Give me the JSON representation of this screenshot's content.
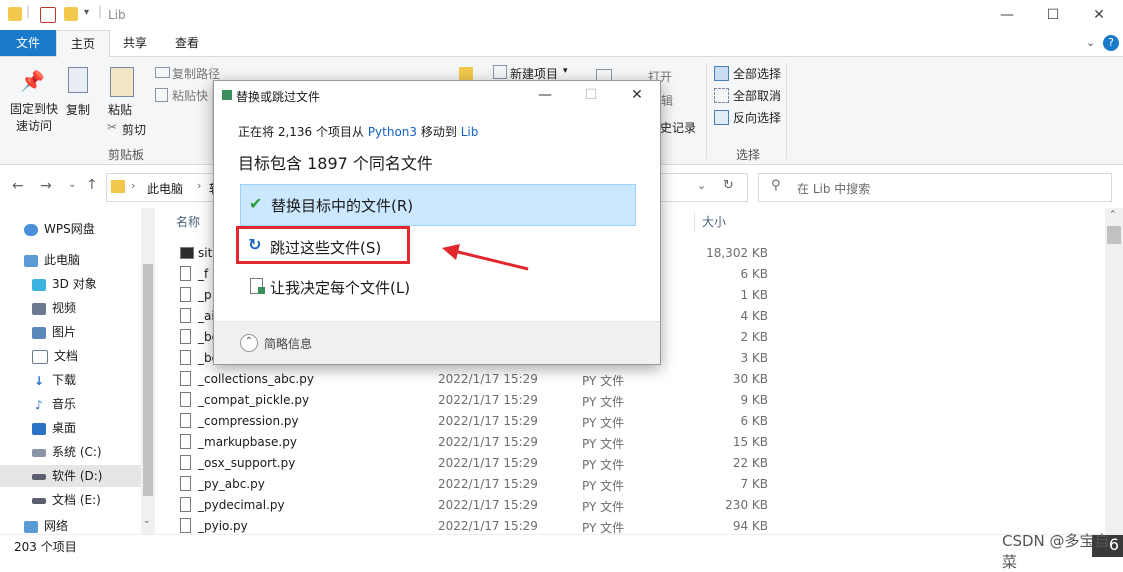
{
  "window": {
    "title": "Lib"
  },
  "tabs": {
    "file": "文件",
    "home": "主页",
    "share": "共享",
    "view": "查看"
  },
  "ribbon": {
    "pin": "固定到快\n速访问",
    "copy": "复制",
    "paste": "粘贴",
    "copy_path": "复制路径",
    "paste_shortcut": "粘贴快",
    "cut": "剪切",
    "clipboard_group": "剪贴板",
    "new_item": "新建项目",
    "open": "打开",
    "history_frag": "史记录",
    "edit_frag": "辑",
    "select_all": "全部选择",
    "select_none": "全部取消",
    "invert_select": "反向选择",
    "select_group": "选择"
  },
  "address": {
    "this_pc": "此电脑",
    "frag": "软"
  },
  "search": {
    "placeholder": "在 Lib 中搜索"
  },
  "sidebar": {
    "items": [
      {
        "label": "WPS网盘"
      },
      {
        "label": "此电脑"
      },
      {
        "label": "3D 对象"
      },
      {
        "label": "视频"
      },
      {
        "label": "图片"
      },
      {
        "label": "文档"
      },
      {
        "label": "下载"
      },
      {
        "label": "音乐"
      },
      {
        "label": "桌面"
      },
      {
        "label": "系统 (C:)"
      },
      {
        "label": "软件 (D:)"
      },
      {
        "label": "文档 (E:)"
      },
      {
        "label": "网络"
      }
    ]
  },
  "columns": {
    "name": "名称",
    "size": "大小"
  },
  "files": [
    {
      "name": "site",
      "date": "",
      "type": "",
      "size": "18,302 KB"
    },
    {
      "name": "_f",
      "date": "",
      "type": "",
      "size": "6 KB"
    },
    {
      "name": "_p",
      "date": "",
      "type": "",
      "size": "1 KB"
    },
    {
      "name": "_ai",
      "date": "",
      "type": "",
      "size": "4 KB"
    },
    {
      "name": "_bo",
      "date": "",
      "type": "",
      "size": "2 KB"
    },
    {
      "name": "_bo",
      "date": "",
      "type": "",
      "size": "3 KB"
    },
    {
      "name": "_collections_abc.py",
      "date": "2022/1/17 15:29",
      "type": "PY 文件",
      "size": "30 KB"
    },
    {
      "name": "_compat_pickle.py",
      "date": "2022/1/17 15:29",
      "type": "PY 文件",
      "size": "9 KB"
    },
    {
      "name": "_compression.py",
      "date": "2022/1/17 15:29",
      "type": "PY 文件",
      "size": "6 KB"
    },
    {
      "name": "_markupbase.py",
      "date": "2022/1/17 15:29",
      "type": "PY 文件",
      "size": "15 KB"
    },
    {
      "name": "_osx_support.py",
      "date": "2022/1/17 15:29",
      "type": "PY 文件",
      "size": "22 KB"
    },
    {
      "name": "_py_abc.py",
      "date": "2022/1/17 15:29",
      "type": "PY 文件",
      "size": "7 KB"
    },
    {
      "name": "_pydecimal.py",
      "date": "2022/1/17 15:29",
      "type": "PY 文件",
      "size": "230 KB"
    },
    {
      "name": "_pyio.py",
      "date": "2022/1/17 15:29",
      "type": "PY 文件",
      "size": "94 KB"
    }
  ],
  "status": {
    "count": "203 个项目"
  },
  "dialog": {
    "title": "替换或跳过文件",
    "info_prefix": "正在将 2,136 个项目从",
    "source": "Python3",
    "info_mid": "移动到",
    "dest": "Lib",
    "heading": "目标包含 1897 个同名文件",
    "opt_replace": "替换目标中的文件(R)",
    "opt_skip": "跳过这些文件(S)",
    "opt_decide": "让我决定每个文件(L)",
    "details": "简略信息"
  },
  "watermark": "CSDN @多宝自菜",
  "corner_digit": "6",
  "colors": {
    "accent": "#1979ca",
    "highlight": "#cce8ff",
    "annotation_red": "#e0282e",
    "link": "#1463c4"
  }
}
